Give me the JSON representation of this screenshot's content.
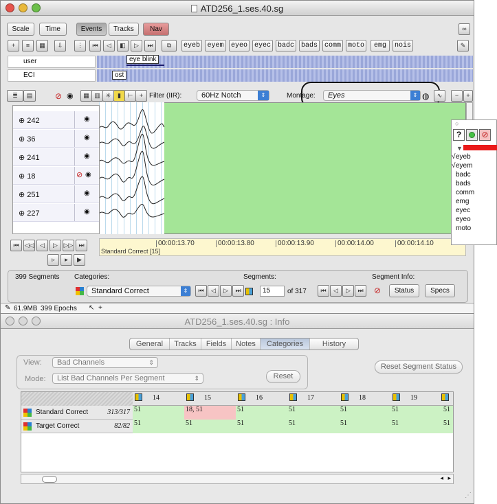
{
  "window1": {
    "title": "ATD256_1.ses.40.sg",
    "view_tabs": [
      {
        "label": "Scale",
        "state": "normal"
      },
      {
        "label": "Time",
        "state": "normal"
      },
      {
        "label": "Events",
        "state": "selected"
      },
      {
        "label": "Tracks",
        "state": "normal"
      },
      {
        "label": "Nav",
        "state": "highlighted"
      }
    ],
    "event_types": [
      "eyeb",
      "eyem",
      "eyeo",
      "eyec",
      "badc",
      "bads",
      "comm",
      "moto",
      "emg",
      "nois"
    ],
    "tracks": [
      {
        "name": "user",
        "event_tag": "eye blink"
      },
      {
        "name": "ECI",
        "event_tag": "ost"
      }
    ],
    "filter": {
      "label": "Filter (IIR):",
      "value": "60Hz Notch"
    },
    "montage": {
      "label": "Montage:",
      "value": "Eyes"
    },
    "channels": [
      "242",
      "36",
      "241",
      "18",
      "251",
      "227"
    ],
    "time_ticks": [
      "00:00:13.70",
      "00:00:13.80",
      "00:00:13.90",
      "00:00:14.00",
      "00:00:14.10"
    ],
    "segment_label": "Standard Correct [15]",
    "segments_panel": {
      "count_text": "399 Segments",
      "categories_label": "Categories:",
      "category_value": "Standard Correct",
      "segments_label": "Segments:",
      "segment_number": "15",
      "segment_of": "of 317",
      "segment_info_label": "Segment Info:",
      "status_button": "Status",
      "specs_button": "Specs"
    },
    "status_bar": {
      "memory": "61.9MB",
      "epochs": "399 Epochs"
    }
  },
  "event_overlay": {
    "items": [
      {
        "label": "eyeb",
        "checked": true
      },
      {
        "label": "eyem",
        "checked": true
      },
      {
        "label": "badc",
        "checked": false
      },
      {
        "label": "bads",
        "checked": false
      },
      {
        "label": "comm",
        "checked": false
      },
      {
        "label": "emg",
        "checked": false
      },
      {
        "label": "eyec",
        "checked": false
      },
      {
        "label": "eyeo",
        "checked": false
      },
      {
        "label": "moto",
        "checked": false
      }
    ]
  },
  "window2": {
    "title": "ATD256_1.ses.40.sg : Info",
    "tabs": [
      "General",
      "Tracks",
      "Fields",
      "Notes",
      "Categories",
      "History"
    ],
    "selected_tab": "Categories",
    "view_label": "View:",
    "view_value": "Bad Channels",
    "mode_label": "Mode:",
    "mode_value": "List Bad Channels Per Segment",
    "reset_button": "Reset",
    "reset_segment_status_button": "Reset Segment Status",
    "columns": [
      "14",
      "15",
      "16",
      "17",
      "18",
      "19"
    ],
    "rows": [
      {
        "name": "Standard Correct",
        "count": "313/317",
        "cells": [
          "51",
          "18, 51",
          "51",
          "51",
          "51",
          "51",
          "51"
        ]
      },
      {
        "name": "Target Correct",
        "count": "82/82",
        "cells": [
          "51",
          "51",
          "51",
          "51",
          "51",
          "51",
          "51"
        ]
      }
    ]
  },
  "colors": {
    "plot_green": "#a4e597",
    "cell_green": "#ccf2c4",
    "cell_red": "#f7c4c4",
    "lane_blue": "#9aa7d9",
    "nav_red": "#c47070"
  }
}
